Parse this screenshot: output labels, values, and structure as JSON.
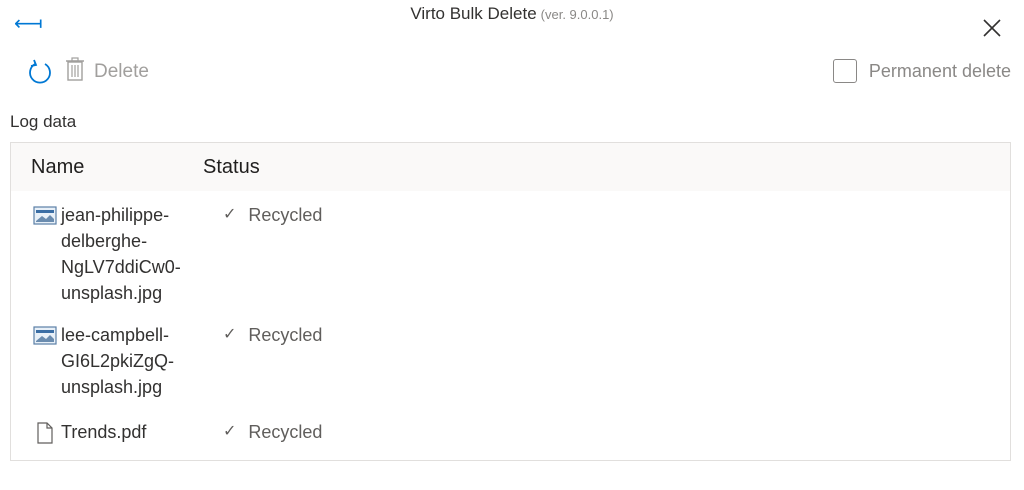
{
  "header": {
    "title": "Virto Bulk Delete",
    "version": "(ver. 9.0.0.1)"
  },
  "toolbar": {
    "delete_label": "Delete",
    "permanent_delete_label": "Permanent delete",
    "permanent_delete_checked": false
  },
  "log": {
    "label": "Log data",
    "columns": {
      "name": "Name",
      "status": "Status"
    },
    "rows": [
      {
        "name": "jean-philippe-delberghe-NgLV7ddiCw0-unsplash.jpg",
        "status": "Recycled",
        "icon": "image-file-icon"
      },
      {
        "name": "lee-campbell-GI6L2pkiZgQ-unsplash.jpg",
        "status": "Recycled",
        "icon": "image-file-icon"
      },
      {
        "name": "Trends.pdf",
        "status": "Recycled",
        "icon": "document-file-icon"
      }
    ]
  },
  "colors": {
    "accent": "#0078d4",
    "disabled": "#a19f9d",
    "border": "#e1dfdd"
  }
}
